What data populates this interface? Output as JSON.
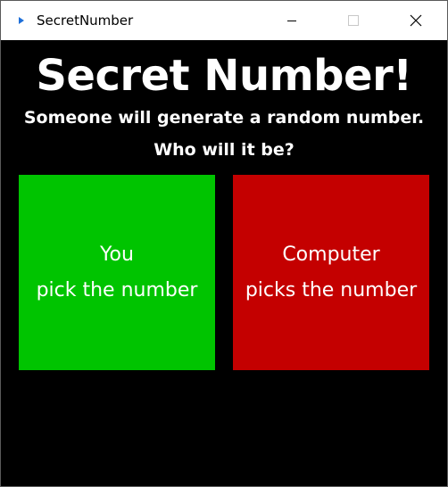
{
  "window": {
    "title": "SecretNumber",
    "icons": {
      "app": "app-icon",
      "minimize": "minimize-icon",
      "maximize": "maximize-icon",
      "close": "close-icon"
    }
  },
  "main": {
    "heading": "Secret Number!",
    "subtitle_line1": "Someone will generate a random number.",
    "subtitle_line2": "Who will it be?",
    "choices": [
      {
        "line1": "You",
        "line2": "pick the number",
        "color": "#00c400"
      },
      {
        "line1": "Computer",
        "line2": "picks the number",
        "color": "#c40000"
      }
    ]
  },
  "colors": {
    "background": "#000000",
    "text": "#ffffff",
    "titlebar": "#ffffff"
  }
}
